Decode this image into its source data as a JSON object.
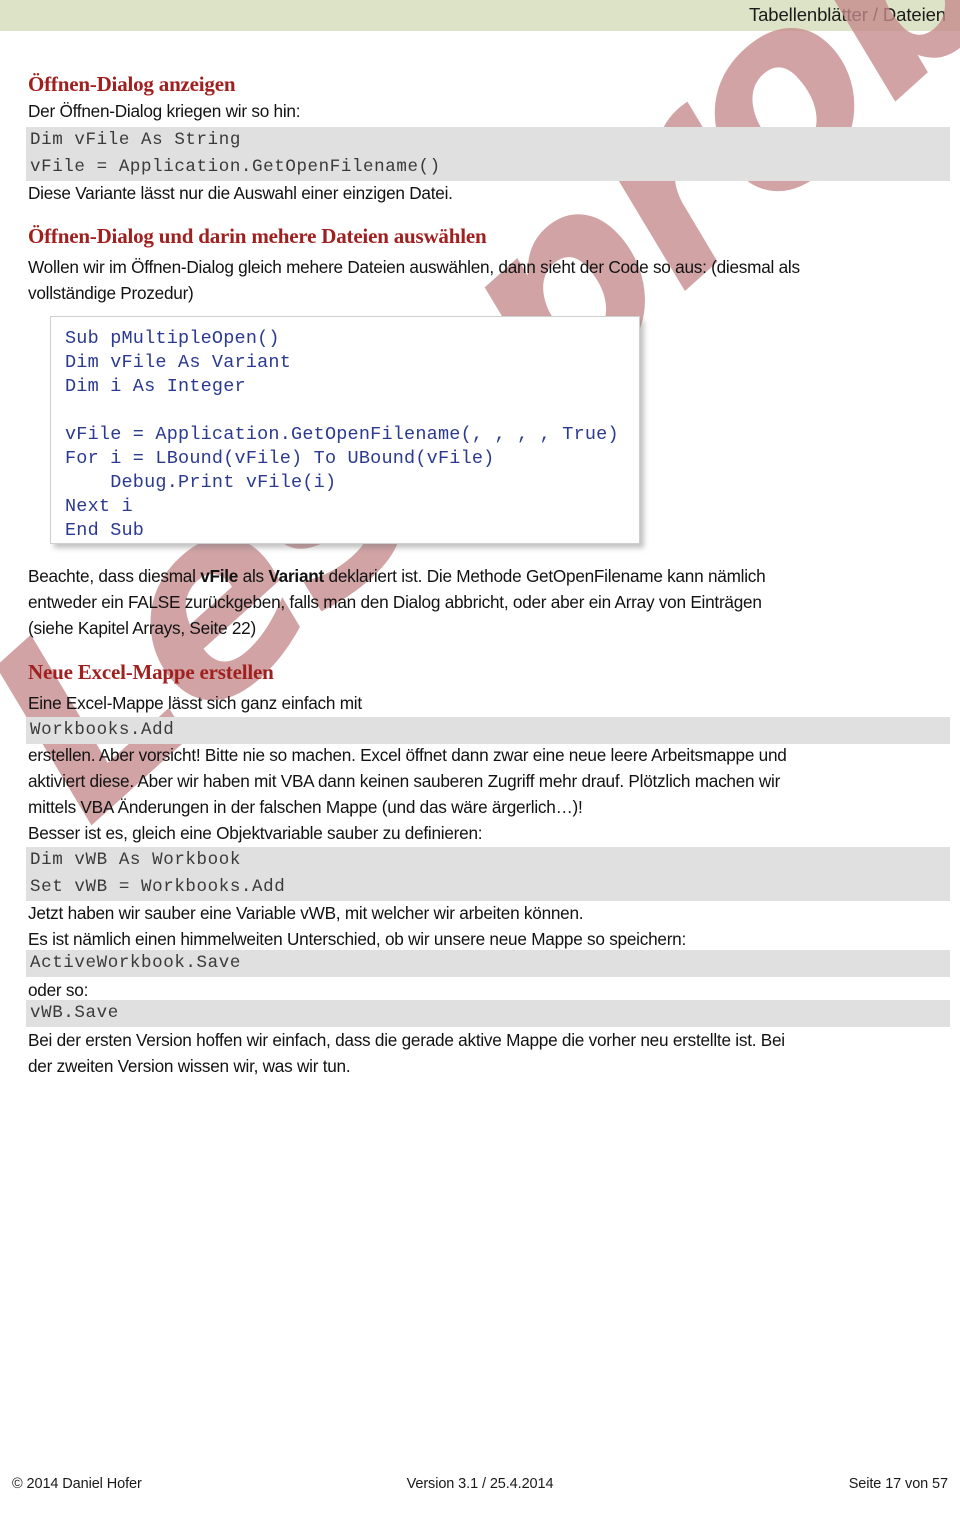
{
  "header": {
    "title": "Tabellenblätter / Dateien",
    "band_color": "#dde3c6"
  },
  "watermark": {
    "text": "Leseprobe",
    "color": "#c58a8c"
  },
  "theme": {
    "heading_color": "#a02020",
    "code_band_color": "#e0e0e0",
    "code_text_color": "#2b3a8f",
    "body_text_color": "#121212"
  },
  "sections": {
    "s1": {
      "heading": "Öffnen-Dialog anzeigen",
      "intro": "Der Öffnen-Dialog kriegen wir so hin:",
      "code_line_1": "Dim vFile As String",
      "code_line_2": "vFile = Application.GetOpenFilename()",
      "outro": "Diese Variante lässt nur die Auswahl einer einzigen Datei."
    },
    "s2": {
      "heading": "Öffnen-Dialog und darin mehere Dateien auswählen",
      "para_line_1": "Wollen wir im Öffnen-Dialog gleich mehere Dateien auswählen, dann sieht der Code so aus: (diesmal als",
      "para_line_2": "vollständige Prozedur)",
      "codeshot": {
        "lines": [
          "Sub pMultipleOpen()",
          "Dim vFile As Variant",
          "Dim i As Integer",
          "",
          "vFile = Application.GetOpenFilename(, , , , True)",
          "For i = LBound(vFile) To UBound(vFile)",
          "    Debug.Print vFile(i)",
          "Next i",
          "End Sub"
        ]
      },
      "note_pre": "Beachte, dass diesmal ",
      "note_b1": "vFile",
      "note_mid": " als ",
      "note_b2": "Variant",
      "note_post": " deklariert ist. Die Methode GetOpenFilename kann nämlich",
      "note_line_2": "entweder ein FALSE zurückgeben, falls man den Dialog abbricht, oder aber ein Array von Einträgen",
      "note_line_3": "(siehe Kapitel Arrays, Seite 22)"
    },
    "s3": {
      "heading": "Neue Excel-Mappe erstellen",
      "line_1": "Eine Excel-Mappe lässt sich ganz einfach mit",
      "code_1": "Workbooks.Add",
      "line_2": "erstellen. Aber vorsicht! Bitte nie so machen. Excel öffnet dann zwar eine neue leere Arbeitsmappe und",
      "line_3": "aktiviert diese. Aber wir haben mit VBA dann keinen sauberen Zugriff mehr drauf. Plötzlich machen wir",
      "line_4": "mittels VBA Änderungen in der falschen Mappe (und das wäre ärgerlich…)!",
      "line_5": "Besser ist es, gleich eine Objektvariable sauber zu definieren:",
      "code_2a": "Dim vWB As Workbook",
      "code_2b": "Set vWB = Workbooks.Add",
      "line_6": "Jetzt haben wir sauber eine Variable vWB, mit welcher wir arbeiten können.",
      "line_7": "Es ist nämlich einen himmelweiten Unterschied, ob wir unsere neue Mappe so speichern:",
      "code_3": "ActiveWorkbook.Save",
      "line_8": "oder so:",
      "code_4": "vWB.Save",
      "line_9": "Bei der ersten Version hoffen wir einfach, dass die gerade aktive Mappe die vorher neu erstellte ist. Bei",
      "line_10": "der zweiten Version wissen wir, was wir tun."
    }
  },
  "footer": {
    "left": "© 2014 Daniel Hofer",
    "center": "Version 3.1 / 25.4.2014",
    "right": "Seite 17 von 57"
  }
}
